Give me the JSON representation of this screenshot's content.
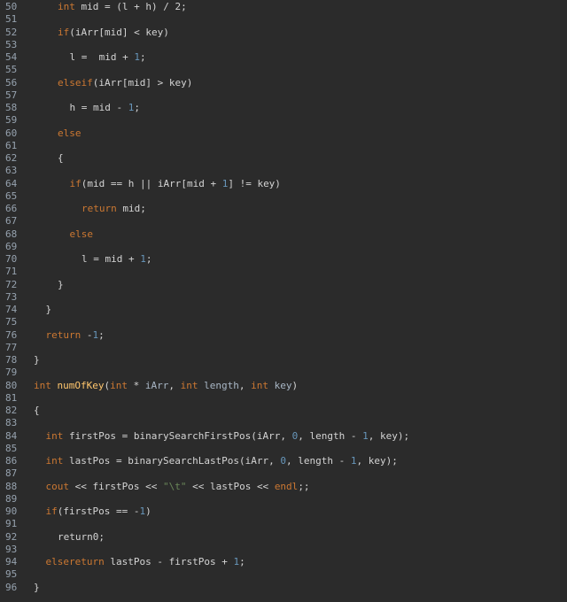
{
  "editor": {
    "lines": [
      {
        "n": "50",
        "indent": 2,
        "tokens": [
          [
            "kw",
            "int"
          ],
          [
            "id",
            " mid = (l + h) / 2;"
          ]
        ]
      },
      {
        "n": "51",
        "indent": 0,
        "tokens": []
      },
      {
        "n": "52",
        "indent": 2,
        "tokens": [
          [
            "kw",
            "if"
          ],
          [
            "id",
            "(iArr[mid] < key)"
          ]
        ]
      },
      {
        "n": "53",
        "indent": 0,
        "tokens": []
      },
      {
        "n": "54",
        "indent": 3,
        "tokens": [
          [
            "id",
            "l =  mid + "
          ],
          [
            "num",
            "1"
          ],
          [
            "id",
            ";"
          ]
        ]
      },
      {
        "n": "55",
        "indent": 0,
        "tokens": []
      },
      {
        "n": "56",
        "indent": 2,
        "tokens": [
          [
            "kw",
            "else"
          ],
          [
            "kw",
            "if"
          ],
          [
            "id",
            "(iArr[mid] > key)"
          ]
        ]
      },
      {
        "n": "57",
        "indent": 0,
        "tokens": []
      },
      {
        "n": "58",
        "indent": 3,
        "tokens": [
          [
            "id",
            "h = mid - "
          ],
          [
            "num",
            "1"
          ],
          [
            "id",
            ";"
          ]
        ]
      },
      {
        "n": "59",
        "indent": 0,
        "tokens": []
      },
      {
        "n": "60",
        "indent": 2,
        "tokens": [
          [
            "kw",
            "else"
          ]
        ]
      },
      {
        "n": "61",
        "indent": 0,
        "tokens": []
      },
      {
        "n": "62",
        "indent": 2,
        "tokens": [
          [
            "id",
            "{"
          ]
        ]
      },
      {
        "n": "63",
        "indent": 0,
        "tokens": []
      },
      {
        "n": "64",
        "indent": 3,
        "tokens": [
          [
            "kw",
            "if"
          ],
          [
            "id",
            "(mid == h || iArr[mid + "
          ],
          [
            "num",
            "1"
          ],
          [
            "id",
            "] != key)"
          ]
        ]
      },
      {
        "n": "65",
        "indent": 0,
        "tokens": []
      },
      {
        "n": "66",
        "indent": 4,
        "tokens": [
          [
            "kw",
            "return"
          ],
          [
            "id",
            " mid;"
          ]
        ]
      },
      {
        "n": "67",
        "indent": 0,
        "tokens": []
      },
      {
        "n": "68",
        "indent": 3,
        "tokens": [
          [
            "kw",
            "else"
          ]
        ]
      },
      {
        "n": "69",
        "indent": 0,
        "tokens": []
      },
      {
        "n": "70",
        "indent": 4,
        "tokens": [
          [
            "id",
            "l = mid + "
          ],
          [
            "num",
            "1"
          ],
          [
            "id",
            ";"
          ]
        ]
      },
      {
        "n": "71",
        "indent": 0,
        "tokens": []
      },
      {
        "n": "72",
        "indent": 2,
        "tokens": [
          [
            "id",
            "}"
          ]
        ]
      },
      {
        "n": "73",
        "indent": 0,
        "tokens": []
      },
      {
        "n": "74",
        "indent": 1,
        "tokens": [
          [
            "id",
            "}"
          ]
        ]
      },
      {
        "n": "75",
        "indent": 0,
        "tokens": []
      },
      {
        "n": "76",
        "indent": 1,
        "tokens": [
          [
            "kw",
            "return"
          ],
          [
            "id",
            " -"
          ],
          [
            "num",
            "1"
          ],
          [
            "id",
            ";"
          ]
        ]
      },
      {
        "n": "77",
        "indent": 0,
        "tokens": []
      },
      {
        "n": "78",
        "indent": 0,
        "tokens": [
          [
            "id",
            "}"
          ]
        ]
      },
      {
        "n": "79",
        "indent": 0,
        "tokens": []
      },
      {
        "n": "80",
        "indent": 0,
        "tokens": [
          [
            "kw",
            "int"
          ],
          [
            "id",
            " "
          ],
          [
            "fn",
            "numOfKey"
          ],
          [
            "id",
            "("
          ],
          [
            "kw",
            "int"
          ],
          [
            "id",
            " * "
          ],
          [
            "var",
            "iArr"
          ],
          [
            "id",
            ", "
          ],
          [
            "kw",
            "int"
          ],
          [
            "id",
            " "
          ],
          [
            "var",
            "length"
          ],
          [
            "id",
            ", "
          ],
          [
            "kw",
            "int"
          ],
          [
            "id",
            " "
          ],
          [
            "var",
            "key"
          ],
          [
            "id",
            ")"
          ]
        ]
      },
      {
        "n": "81",
        "indent": 0,
        "tokens": []
      },
      {
        "n": "82",
        "indent": 0,
        "tokens": [
          [
            "id",
            "{"
          ]
        ]
      },
      {
        "n": "83",
        "indent": 0,
        "tokens": []
      },
      {
        "n": "84",
        "indent": 1,
        "tokens": [
          [
            "kw",
            "int"
          ],
          [
            "id",
            " firstPos = binarySearchFirstPos(iArr, "
          ],
          [
            "num",
            "0"
          ],
          [
            "id",
            ", length - "
          ],
          [
            "num",
            "1"
          ],
          [
            "id",
            ", key);"
          ]
        ]
      },
      {
        "n": "85",
        "indent": 0,
        "tokens": []
      },
      {
        "n": "86",
        "indent": 1,
        "tokens": [
          [
            "kw",
            "int"
          ],
          [
            "id",
            " lastPos = binarySearchLastPos(iArr, "
          ],
          [
            "num",
            "0"
          ],
          [
            "id",
            ", length - "
          ],
          [
            "num",
            "1"
          ],
          [
            "id",
            ", key);"
          ]
        ]
      },
      {
        "n": "87",
        "indent": 0,
        "tokens": []
      },
      {
        "n": "88",
        "indent": 1,
        "tokens": [
          [
            "kw",
            "cout"
          ],
          [
            "id",
            " << firstPos << "
          ],
          [
            "str",
            "\"\\t\""
          ],
          [
            "id",
            " << lastPos << "
          ],
          [
            "kw",
            "endl"
          ],
          [
            "id",
            ";;"
          ]
        ]
      },
      {
        "n": "89",
        "indent": 0,
        "tokens": []
      },
      {
        "n": "90",
        "indent": 1,
        "tokens": [
          [
            "kw",
            "if"
          ],
          [
            "id",
            "(firstPos == -"
          ],
          [
            "num",
            "1"
          ],
          [
            "id",
            ")"
          ]
        ]
      },
      {
        "n": "91",
        "indent": 0,
        "tokens": []
      },
      {
        "n": "92",
        "indent": 2,
        "tokens": [
          [
            "id",
            "return0;"
          ]
        ]
      },
      {
        "n": "93",
        "indent": 0,
        "tokens": []
      },
      {
        "n": "94",
        "indent": 1,
        "tokens": [
          [
            "kw",
            "else"
          ],
          [
            "kw",
            "return"
          ],
          [
            "id",
            " lastPos - firstPos + "
          ],
          [
            "num",
            "1"
          ],
          [
            "id",
            ";"
          ]
        ]
      },
      {
        "n": "95",
        "indent": 0,
        "tokens": []
      },
      {
        "n": "96",
        "indent": 0,
        "tokens": [
          [
            "id",
            "}"
          ]
        ]
      }
    ]
  },
  "colors": {
    "background": "#2b2b2b",
    "keyword": "#cc7832",
    "number": "#6897bb",
    "string": "#6a8759",
    "function": "#ffc66d",
    "line_number": "#a9b7c6",
    "text": "#d4d4d4"
  }
}
